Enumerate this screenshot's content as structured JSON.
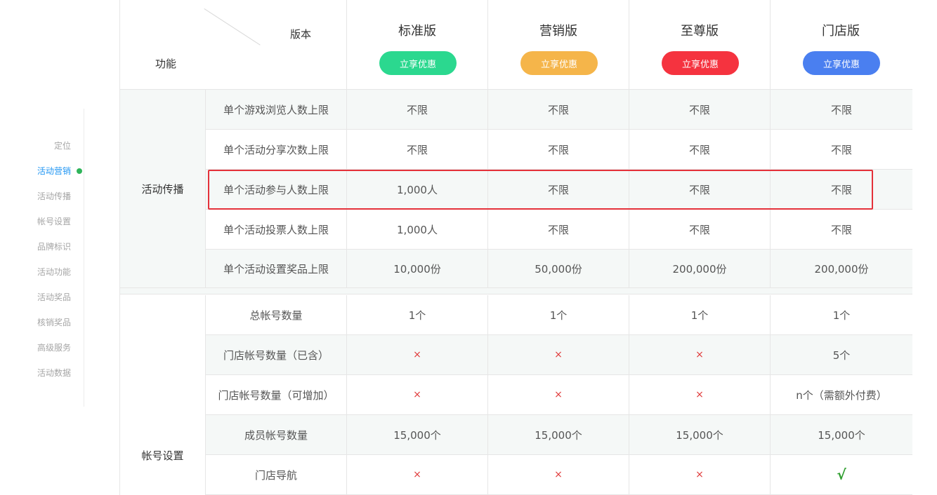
{
  "sidebar": {
    "items": [
      {
        "label": "定位"
      },
      {
        "label": "活动营销"
      },
      {
        "label": "活动传播"
      },
      {
        "label": "帐号设置"
      },
      {
        "label": "品牌标识"
      },
      {
        "label": "活动功能"
      },
      {
        "label": "活动奖品"
      },
      {
        "label": "核销奖品"
      },
      {
        "label": "高级服务"
      },
      {
        "label": "活动数据"
      }
    ],
    "active_index": 1,
    "active_color": "#2196f3",
    "dot_color": "#2fb45a"
  },
  "table": {
    "header": {
      "function_label": "功能",
      "version_label": "版本"
    },
    "plans": [
      {
        "name": "标准版",
        "button": "立享优惠",
        "color": "#2bd88f"
      },
      {
        "name": "营销版",
        "button": "立享优惠",
        "color": "#f5b54a"
      },
      {
        "name": "至尊版",
        "button": "立享优惠",
        "color": "#f5333f"
      },
      {
        "name": "门店版",
        "button": "立享优惠",
        "color": "#4a7ff0"
      }
    ],
    "sections": [
      {
        "label": "活动传播",
        "rows": [
          {
            "feature": "单个游戏浏览人数上限",
            "values": [
              "不限",
              "不限",
              "不限",
              "不限"
            ]
          },
          {
            "feature": "单个活动分享次数上限",
            "values": [
              "不限",
              "不限",
              "不限",
              "不限"
            ]
          },
          {
            "feature": "单个活动参与人数上限",
            "values": [
              "1,000人",
              "不限",
              "不限",
              "不限"
            ]
          },
          {
            "feature": "单个活动投票人数上限",
            "values": [
              "1,000人",
              "不限",
              "不限",
              "不限"
            ]
          },
          {
            "feature": "单个活动设置奖品上限",
            "values": [
              "10,000份",
              "50,000份",
              "200,000份",
              "200,000份"
            ]
          }
        ]
      },
      {
        "label": "帐号设置",
        "rows": [
          {
            "feature": "总帐号数量",
            "values": [
              "1个",
              "1个",
              "1个",
              "1个"
            ]
          },
          {
            "feature": "门店帐号数量（已含）",
            "values": [
              "×",
              "×",
              "×",
              "5个"
            ]
          },
          {
            "feature": "门店帐号数量（可增加）",
            "values": [
              "×",
              "×",
              "×",
              "n个（需额外付费）"
            ]
          },
          {
            "feature": "成员帐号数量",
            "values": [
              "15,000个",
              "15,000个",
              "15,000个",
              "15,000个"
            ]
          },
          {
            "feature": "门店导航",
            "values": [
              "×",
              "×",
              "×",
              "√"
            ]
          }
        ]
      }
    ],
    "highlighted_row": "单个活动参与人数上限",
    "highlight_color": "#e4313a"
  }
}
